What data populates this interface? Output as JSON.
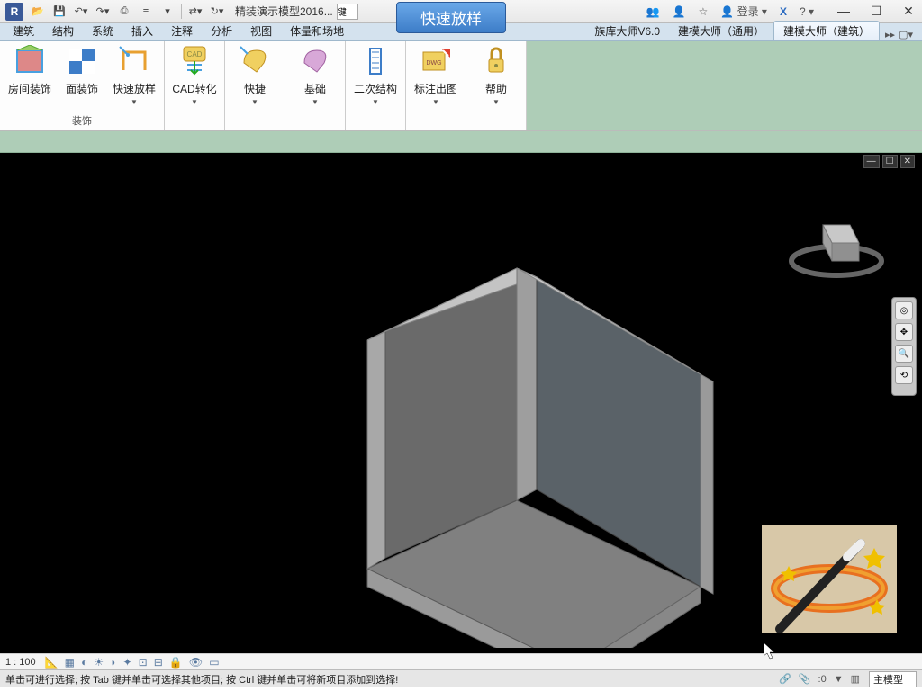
{
  "app_icon_letter": "R",
  "project_name": "精装演示模型2016...",
  "search_hint": "键",
  "big_button": "快速放样",
  "title_right": {
    "login": "登录",
    "x_icon": "X"
  },
  "menu": {
    "items": [
      "建筑",
      "结构",
      "系统",
      "插入",
      "注释",
      "分析",
      "视图",
      "体量和场地"
    ],
    "extra": [
      "族库大师V6.0",
      "建模大师（通用）"
    ],
    "active": "建模大师（建筑）"
  },
  "ribbon": {
    "group1": {
      "label": "装饰",
      "btns": [
        "房间装饰",
        "面装饰",
        "快速放样"
      ]
    },
    "btns_standalone": [
      "CAD转化",
      "快捷",
      "基础",
      "二次结构",
      "标注出图",
      "帮助"
    ]
  },
  "view_status": {
    "scale": "1 : 100"
  },
  "statusbar": {
    "hint": "单击可进行选择; 按 Tab 键并单击可选择其他项目; 按 Ctrl 键并单击可将新项目添加到选择!",
    "count": ":0",
    "model_dropdown": "主模型"
  }
}
